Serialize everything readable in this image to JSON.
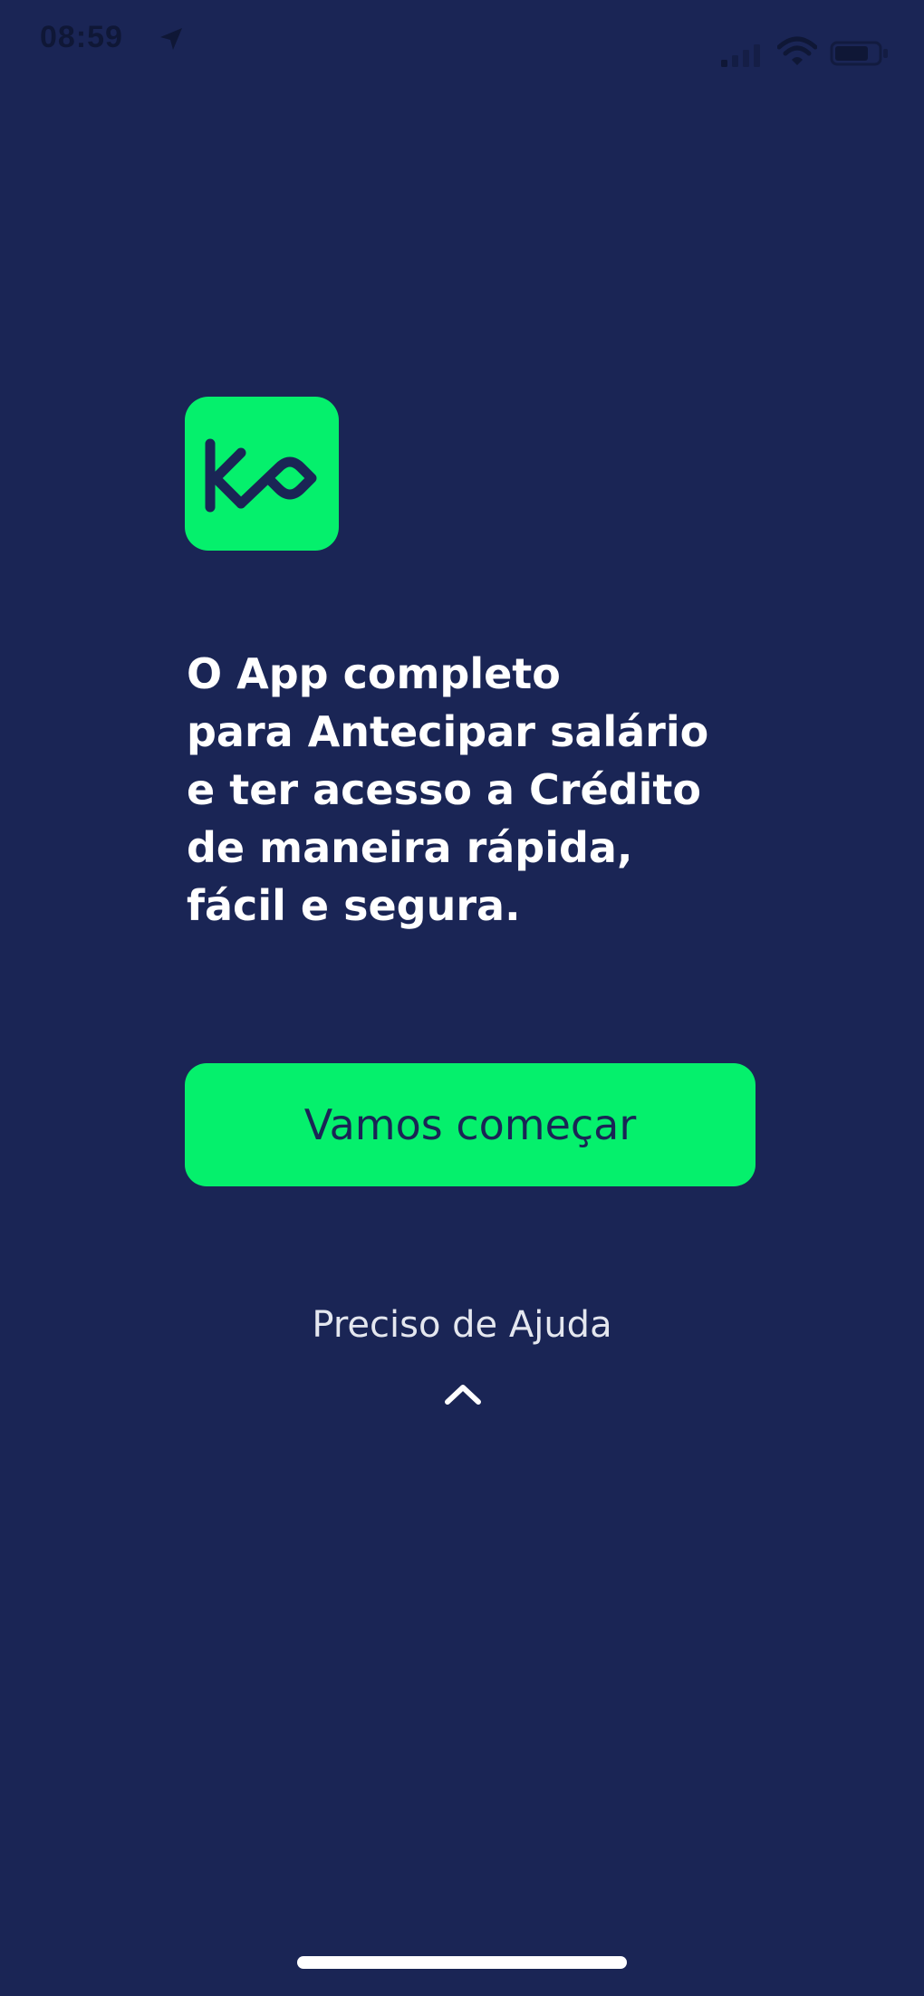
{
  "status_bar": {
    "time": "08:59",
    "icons": [
      "location-arrow-icon",
      "cellular-signal-icon",
      "wifi-icon",
      "battery-icon"
    ]
  },
  "logo": {
    "icon": "ko-infinity-logo-icon",
    "color": "#05f06c",
    "glyph_color": "#1a2555"
  },
  "onboarding": {
    "headline": "O App completo\npara Antecipar salário\ne ter acesso a Crédito\nde maneira rápida,\nfácil e segura.",
    "primary_button_label": "Vamos começar",
    "help_link_label": "Preciso de Ajuda",
    "help_icon": "chevron-up-icon"
  },
  "colors": {
    "background": "#1a2555",
    "accent": "#05f06c",
    "text": "#ffffff"
  }
}
